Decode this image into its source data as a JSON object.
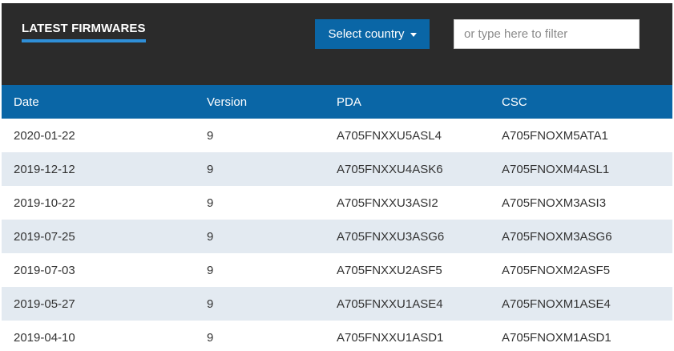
{
  "header": {
    "title": "LATEST FIRMWARES",
    "country_button_label": "Select country",
    "filter_placeholder": "or type here to filter"
  },
  "table": {
    "columns": [
      "Date",
      "Version",
      "PDA",
      "CSC"
    ],
    "rows": [
      [
        "2020-01-22",
        "9",
        "A705FNXXU5ASL4",
        "A705FNOXM5ATA1"
      ],
      [
        "2019-12-12",
        "9",
        "A705FNXXU4ASK6",
        "A705FNOXM4ASL1"
      ],
      [
        "2019-10-22",
        "9",
        "A705FNXXU3ASI2",
        "A705FNOXM3ASI3"
      ],
      [
        "2019-07-25",
        "9",
        "A705FNXXU3ASG6",
        "A705FNOXM3ASG6"
      ],
      [
        "2019-07-03",
        "9",
        "A705FNXXU2ASF5",
        "A705FNOXM2ASF5"
      ],
      [
        "2019-05-27",
        "9",
        "A705FNXXU1ASE4",
        "A705FNOXM1ASE4"
      ],
      [
        "2019-04-10",
        "9",
        "A705FNXXU1ASD1",
        "A705FNOXM1ASD1"
      ]
    ]
  },
  "colors": {
    "header_bg": "#2b2b2b",
    "accent": "#0a66a6",
    "underline": "#2f8fd8",
    "row_alt": "#e3eaf1"
  }
}
